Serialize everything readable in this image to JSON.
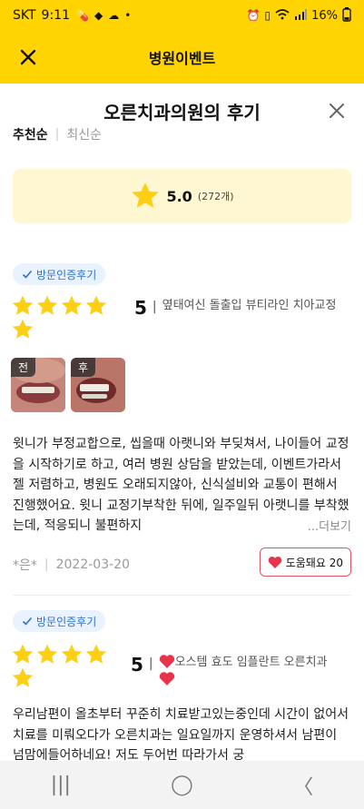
{
  "statusbar": {
    "carrier": "SKT",
    "time": "9:11",
    "battery": "16%",
    "icons": [
      "pill-icon",
      "tag-icon",
      "cloud-icon",
      "dot-icon",
      "alarm-icon",
      "vibrate-icon",
      "wifi-icon",
      "signal-icon"
    ]
  },
  "appbar": {
    "title": "병원이벤트",
    "close_icon": "close-icon"
  },
  "sheet": {
    "title": "오른치과의원의 후기",
    "close_icon": "close-icon"
  },
  "sort": {
    "active": "추천순",
    "inactive": "최신순"
  },
  "rating": {
    "score": "5.0",
    "count": "(272개)",
    "star_color": "#ffcf14"
  },
  "reviews": [
    {
      "badge": "방문인증후기",
      "stars": 5,
      "score": "5",
      "treatment": "옆태여신 돌출입 뷰티라인 치아교정",
      "photos": [
        {
          "tag": "전"
        },
        {
          "tag": "후"
        }
      ],
      "text": "윗니가 부정교합으로, 씹을때 아랫니와 부딪쳐서, 나이들어 교정을 시작하기로 하고, 여러 병원 상담을 받았는데, 이벤트가라서 젤 저렴하고, 병원도 오래되지않아, 신식설비와 교통이 편해서 진행했어요. 윗니 교정기부착한 뒤에, 일주일뒤 아랫니를 부착했는데, 적응되니 불편하지",
      "more": "...더보기",
      "author": "*은*",
      "date": "2022-03-20",
      "helpful": "도움돼요 20"
    },
    {
      "badge": "방문인증후기",
      "stars": 5,
      "score": "5",
      "treatment": "오스템 효도 임플란트 오른치과",
      "text": "우리남편이 올초부터 꾸준히 치료받고있는중인데 시간이 없어서 치료를 미뤄오다가 오른치과는 일요일까지 운영하셔서 남편이 넘맘에들어하네요! 저도 두어번 따라가서 궁"
    }
  ],
  "navbar": {
    "recent": "|||",
    "home": "◯",
    "back": "〈"
  },
  "colors": {
    "brand": "#ffd400",
    "badge_text": "#2f6fd0",
    "heart": "#e8344a"
  }
}
